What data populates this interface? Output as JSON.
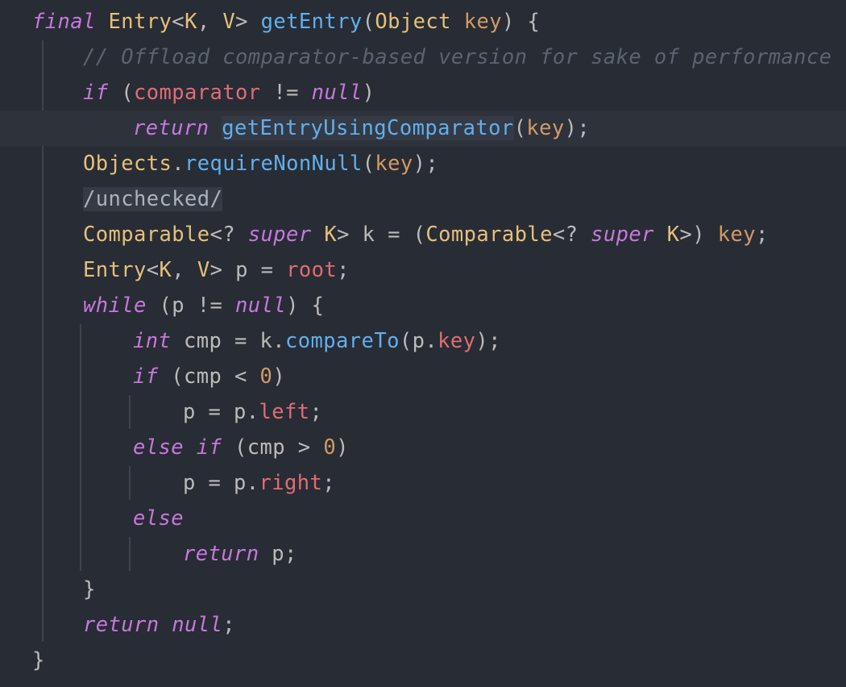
{
  "editor": {
    "theme": {
      "background": "#282c34",
      "keyword": "#c678dd",
      "type": "#e5c07b",
      "method": "#61afef",
      "field": "#e06c75",
      "parameter": "#d19a66",
      "comment": "#5c6370",
      "plain": "#bbbbbb"
    },
    "lines": [
      [
        [
          "kw",
          "final"
        ],
        [
          "pl",
          " "
        ],
        [
          "ty",
          "Entry"
        ],
        [
          "pl",
          "<"
        ],
        [
          "ty",
          "K"
        ],
        [
          "pl",
          ", "
        ],
        [
          "ty",
          "V"
        ],
        [
          "pl",
          "> "
        ],
        [
          "fn",
          "getEntry"
        ],
        [
          "pl",
          "("
        ],
        [
          "ty",
          "Object"
        ],
        [
          "pl",
          " "
        ],
        [
          "prm",
          "key"
        ],
        [
          "pl",
          ") {"
        ]
      ],
      [
        [
          "cm",
          "// Offload comparator-based version for sake of performance"
        ]
      ],
      [
        [
          "kw",
          "if"
        ],
        [
          "pl",
          " ("
        ],
        [
          "fld",
          "comparator"
        ],
        [
          "pl",
          " != "
        ],
        [
          "kw",
          "null"
        ],
        [
          "pl",
          ")"
        ]
      ],
      [
        [
          "kw",
          "return"
        ],
        [
          "pl",
          " "
        ],
        [
          "fn hl",
          "getEntryUsingComparator"
        ],
        [
          "pl",
          "("
        ],
        [
          "prm",
          "key"
        ],
        [
          "pl",
          ");"
        ]
      ],
      [
        [
          "ty",
          "Objects"
        ],
        [
          "pl",
          "."
        ],
        [
          "fn",
          "requireNonNull"
        ],
        [
          "pl",
          "("
        ],
        [
          "prm",
          "key"
        ],
        [
          "pl",
          ");"
        ]
      ],
      [
        [
          "mark",
          "/unchecked/"
        ]
      ],
      [
        [
          "ty",
          "Comparable"
        ],
        [
          "pl",
          "<? "
        ],
        [
          "kw",
          "super"
        ],
        [
          "pl",
          " "
        ],
        [
          "ty",
          "K"
        ],
        [
          "pl",
          "> k = ("
        ],
        [
          "ty",
          "Comparable"
        ],
        [
          "pl",
          "<? "
        ],
        [
          "kw",
          "super"
        ],
        [
          "pl",
          " "
        ],
        [
          "ty",
          "K"
        ],
        [
          "pl",
          ">) "
        ],
        [
          "prm",
          "key"
        ],
        [
          "pl",
          ";"
        ]
      ],
      [
        [
          "ty",
          "Entry"
        ],
        [
          "pl",
          "<"
        ],
        [
          "ty",
          "K"
        ],
        [
          "pl",
          ", "
        ],
        [
          "ty",
          "V"
        ],
        [
          "pl",
          "> p = "
        ],
        [
          "fld",
          "root"
        ],
        [
          "pl",
          ";"
        ]
      ],
      [
        [
          "kw",
          "while"
        ],
        [
          "pl",
          " (p != "
        ],
        [
          "kw",
          "null"
        ],
        [
          "pl",
          ") {"
        ]
      ],
      [
        [
          "kw",
          "int"
        ],
        [
          "pl",
          " cmp = k."
        ],
        [
          "fn",
          "compareTo"
        ],
        [
          "pl",
          "(p."
        ],
        [
          "fld",
          "key"
        ],
        [
          "pl",
          ");"
        ]
      ],
      [
        [
          "kw",
          "if"
        ],
        [
          "pl",
          " (cmp < "
        ],
        [
          "num",
          "0"
        ],
        [
          "pl",
          ")"
        ]
      ],
      [
        [
          "pl",
          "p = p."
        ],
        [
          "fld",
          "left"
        ],
        [
          "pl",
          ";"
        ]
      ],
      [
        [
          "kw",
          "else if"
        ],
        [
          "pl",
          " (cmp > "
        ],
        [
          "num",
          "0"
        ],
        [
          "pl",
          ")"
        ]
      ],
      [
        [
          "pl",
          "p = p."
        ],
        [
          "fld",
          "right"
        ],
        [
          "pl",
          ";"
        ]
      ],
      [
        [
          "kw",
          "else"
        ]
      ],
      [
        [
          "kw",
          "return"
        ],
        [
          "pl",
          " p;"
        ]
      ],
      [
        [
          "pl",
          "}"
        ]
      ],
      [
        [
          "kw",
          "return"
        ],
        [
          "pl",
          " "
        ],
        [
          "kw",
          "null"
        ],
        [
          "pl",
          ";"
        ]
      ],
      [
        [
          "pl",
          "}"
        ]
      ]
    ]
  }
}
